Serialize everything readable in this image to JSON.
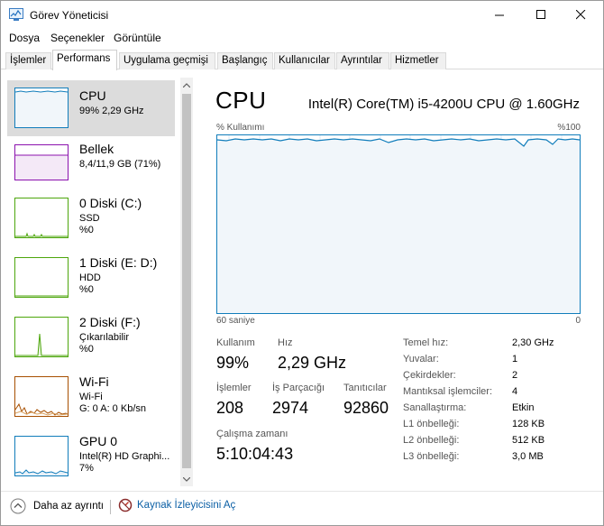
{
  "window": {
    "title": "Görev Yöneticisi"
  },
  "menu": [
    "Dosya",
    "Seçenekler",
    "Görüntüle"
  ],
  "tabs": [
    {
      "label": "İşlemler",
      "active": false
    },
    {
      "label": "Performans",
      "active": true
    },
    {
      "label": "Uygulama geçmişi",
      "active": false
    },
    {
      "label": "Başlangıç",
      "active": false
    },
    {
      "label": "Kullanıcılar",
      "active": false
    },
    {
      "label": "Ayrıntılar",
      "active": false
    },
    {
      "label": "Hizmetler",
      "active": false
    }
  ],
  "sidebar": {
    "items": [
      {
        "title": "CPU",
        "lines": [
          "99% 2,29 GHz"
        ],
        "color": "#117dbb",
        "selected": true
      },
      {
        "title": "Bellek",
        "lines": [
          "8,4/11,9 GB (71%)"
        ],
        "color": "#8b12ae",
        "selected": false
      },
      {
        "title": "0 Diski (C:)",
        "lines": [
          "SSD",
          "%0"
        ],
        "color": "#4da60c",
        "selected": false
      },
      {
        "title": "1 Diski (E: D:)",
        "lines": [
          "HDD",
          "%0"
        ],
        "color": "#4da60c",
        "selected": false
      },
      {
        "title": "2 Diski (F:)",
        "lines": [
          "Çıkarılabilir",
          "%0"
        ],
        "color": "#4da60c",
        "selected": false
      },
      {
        "title": "Wi-Fi",
        "lines": [
          "Wi-Fi",
          "G: 0 A: 0 Kb/sn"
        ],
        "color": "#a74f01",
        "selected": false
      },
      {
        "title": "GPU 0",
        "lines": [
          "Intel(R) HD Graphi...",
          "7%"
        ],
        "color": "#117dbb",
        "selected": false
      }
    ]
  },
  "main": {
    "title": "CPU",
    "cpu_name": "Intel(R) Core(TM) i5-4200U CPU @ 1.60GHz",
    "graph_top_left": "% Kullanımı",
    "graph_top_right": "%100",
    "graph_bottom_left": "60 saniye",
    "graph_bottom_right": "0",
    "graph_color": "#117dbb",
    "stats": {
      "usage_label": "Kullanım",
      "usage_value": "99%",
      "speed_label": "Hız",
      "speed_value": "2,29 GHz",
      "processes_label": "İşlemler",
      "processes_value": "208",
      "threads_label": "İş Parçacığı",
      "threads_value": "2974",
      "handles_label": "Tanıtıcılar",
      "handles_value": "92860",
      "uptime_label": "Çalışma zamanı",
      "uptime_value": "5:10:04:43"
    },
    "specs": [
      {
        "label": "Temel hız:",
        "value": "2,30 GHz"
      },
      {
        "label": "Yuvalar:",
        "value": "1"
      },
      {
        "label": "Çekirdekler:",
        "value": "2"
      },
      {
        "label": "Mantıksal işlemciler:",
        "value": "4"
      },
      {
        "label": "Sanallaştırma:",
        "value": "Etkin"
      },
      {
        "label": "L1 önbelleği:",
        "value": "128 KB"
      },
      {
        "label": "L2 önbelleği:",
        "value": "512 KB"
      },
      {
        "label": "L3 önbelleği:",
        "value": "3,0 MB"
      }
    ]
  },
  "footer": {
    "fewer_details": "Daha az ayrıntı",
    "resource_monitor": "Kaynak İzleyicisini Aç",
    "link_color": "#0b5fa5"
  }
}
